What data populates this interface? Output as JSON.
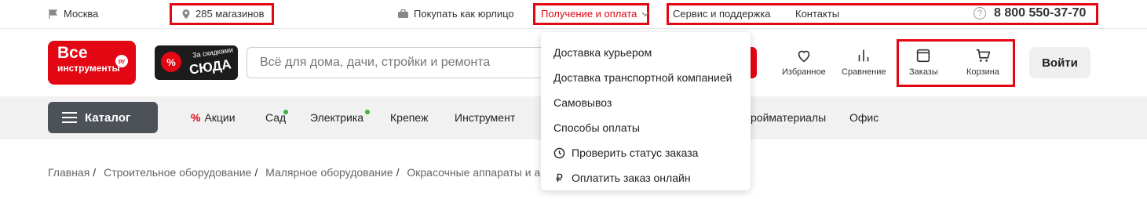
{
  "topbar": {
    "city": "Москва",
    "stores": "285 магазинов",
    "business": "Покупать как юрлицо",
    "delivery": "Получение и оплата",
    "service": "Сервис и поддержка",
    "contacts": "Контакты",
    "help_glyph": "?",
    "phone": "8 800 550-37-70"
  },
  "logo": {
    "line1": "Все",
    "line2": "инструменты",
    "badge": "ру"
  },
  "promo": {
    "line1": "За скидками",
    "line2": "СЮДА",
    "badge": "%"
  },
  "search": {
    "placeholder": "Всё для дома, дачи, стройки и ремонта"
  },
  "header_icons": {
    "favorites": "Избранное",
    "compare": "Сравнение",
    "orders": "Заказы",
    "cart": "Корзина",
    "login": "Войти"
  },
  "nav": {
    "catalog": "Каталог",
    "items": [
      "Акции",
      "Сад",
      "Электрика",
      "Крепеж",
      "Инструмент",
      "ройматериалы",
      "Офис"
    ]
  },
  "breadcrumb": [
    "Главная",
    "Строительное оборудование",
    "Малярное оборудование",
    "Окрасочные аппараты и а"
  ],
  "dropdown": {
    "items": [
      "Доставка курьером",
      "Доставка транспортной компанией",
      "Самовывоз",
      "Способы оплаты",
      "Проверить статус заказа",
      "Оплатить заказ онлайн"
    ],
    "ruble": "₽"
  },
  "colors": {
    "accent": "#e30613",
    "nav_bg": "#f1f1f2",
    "catalog_bg": "#4d5258",
    "dot": "#3cb043"
  },
  "icons": [
    "flag-icon",
    "location-pin-icon",
    "briefcase-icon",
    "chevron-down-icon",
    "question-icon",
    "heart-icon",
    "compare-icon",
    "orders-icon",
    "cart-icon",
    "menu-icon",
    "percent-icon",
    "clock-icon",
    "ruble-icon"
  ]
}
